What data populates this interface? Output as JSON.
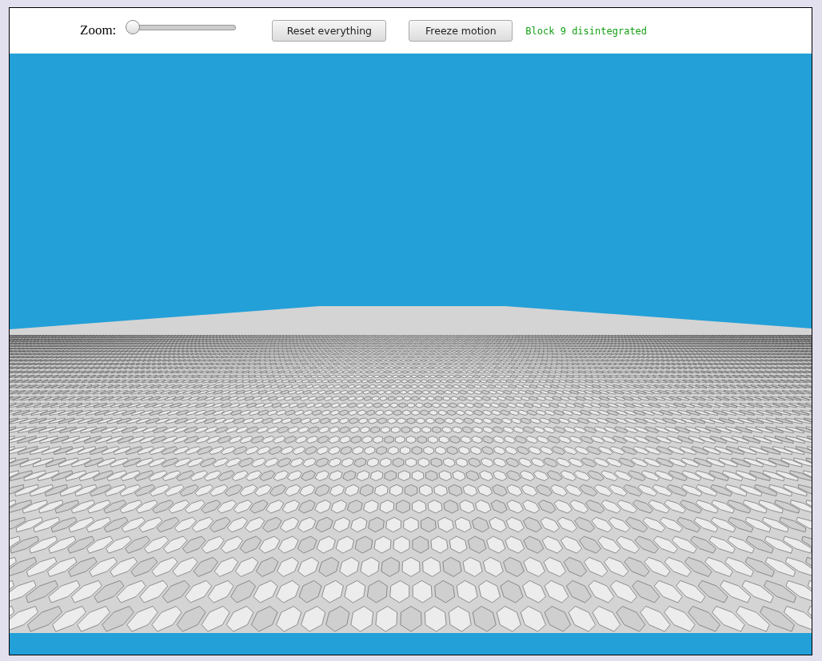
{
  "toolbar": {
    "zoom_label": "Zoom:",
    "zoom_slider": {
      "level": 0
    },
    "buttons": [
      "Reset everything",
      "Freeze motion"
    ],
    "status": "Block 9 disintegrated"
  }
}
